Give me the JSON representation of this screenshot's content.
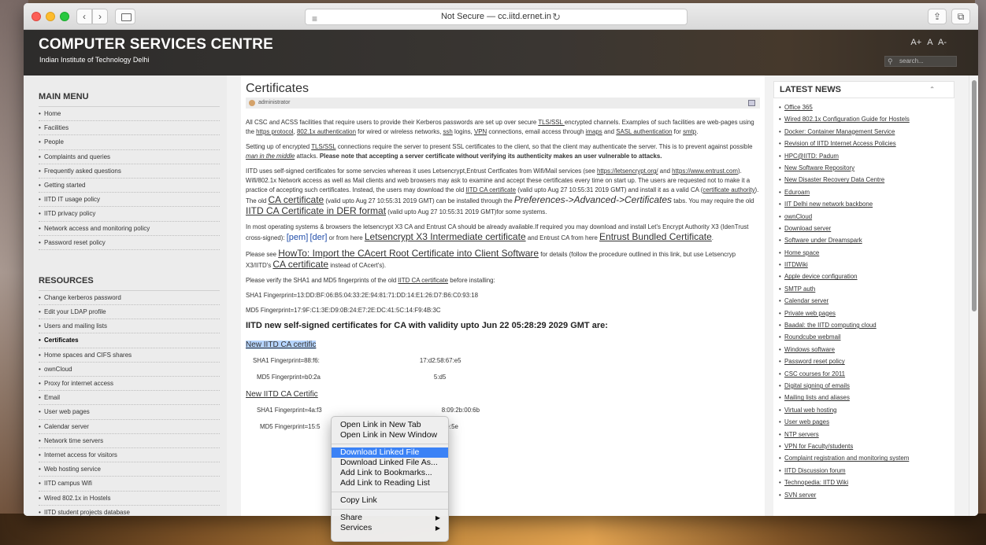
{
  "browser": {
    "address": "Not Secure — cc.iitd.ernet.in"
  },
  "site": {
    "title": "COMPUTER SERVICES CENTRE",
    "subtitle": "Indian Institute of Technology Delhi",
    "font_controls": [
      "A+",
      "A",
      "A-"
    ],
    "search_placeholder": "search..."
  },
  "main_menu": {
    "title": "MAIN MENU",
    "items": [
      "Home",
      "Facilities",
      "People",
      "Complaints and queries",
      "Frequently asked questions",
      "Getting started",
      "IITD IT usage policy",
      "IITD privacy policy",
      "Network access and monitoring policy",
      "Password reset policy"
    ]
  },
  "resources": {
    "title": "RESOURCES",
    "items": [
      "Change kerberos password",
      "Edit your LDAP profile",
      "Users and mailing lists",
      "Certificates",
      "Home spaces and CIFS shares",
      "ownCloud",
      "Proxy for internet access",
      "Email",
      "User web pages",
      "Calendar server",
      "Network time servers",
      "Internet access for visitors",
      "Web hosting service",
      "IITD campus Wifi",
      "Wired 802.1x in Hostels",
      "IITD student projects database"
    ],
    "active": "Certificates"
  },
  "article": {
    "title": "Certificates",
    "author": "administrator",
    "p1_a": "All CSC and ACSS facilities that require users to provide their Kerberos passwords are set up over secure ",
    "p1_tls": "TLS/SSL ",
    "p1_b": "encrypted channels. Examples of such facilities are web-pages using the ",
    "p1_https": "https protocol",
    "p1_c": ", ",
    "p1_8021x": "802.1x authentication",
    "p1_d": " for wired or wireless networks, ",
    "p1_ssh": "ssh",
    "p1_e": " logins, ",
    "p1_vpn": "VPN",
    "p1_f": " connections, email access through ",
    "p1_imaps": "imaps",
    "p1_g": " and ",
    "p1_sasl": "SASL authentication",
    "p1_h": " for ",
    "p1_smtp": "smtp",
    "p1_i": ".",
    "p2_a": "Setting up of encrypted ",
    "p2_tls": "TLS/SSL",
    "p2_b": " connections require the server  to present SSL certificates to the client, so that the client may authenticate the server. This is to prevent against possible ",
    "p2_mitm": "man in the middle",
    "p2_c": " attacks. ",
    "p2_bold": "Please note that accepting a server certificate without verifying its authenticity makes an user vulnerable to attacks.",
    "p3_a": "IITD uses self-signed certificates for some servcies whereas it uses Letsencrypt,Entrust Certficates from Wifi/Mail services (see ",
    "p3_le": "https://letsencrypt.org/",
    "p3_b": " and ",
    "p3_entrust": "https://www.entrust.com",
    "p3_c": ").  Wifi/802.1x Network access as well as Mail clients and web browsers  may ask to examine and accept these certificates every time on start up. The users are requested not to make it a practice of accepting such certificates. Instead, the users may download the old ",
    "p3_oldca": "IITD CA certificate",
    "p3_d": " (valid upto Aug 27 10:55:31 2019 GMT) and install it as a valid CA (",
    "p3_certauth": "certificate authority",
    "p3_e": "). The old ",
    "p3_cacert": "CA certificate",
    "p3_f": " (valid upto Aug 27 10:55:31 2019 GMT) can be installed through the ",
    "p3_prefs": "Preferences->Advanced->Certificates",
    "p3_g": " tabs. You may require the old ",
    "p3_der": "IITD CA Certificate in DER format",
    "p3_h": " (valid upto Aug 27 10:55:31 2019 GMT)for some systems.",
    "p4_a": "In most operating systems & browsers the letsencrypt X3 CA and Entrust CA should be already available.If required you may download and install Let's Encrypt Authority X3 (IdenTrust cross-signed): ",
    "p4_pem": "[pem]",
    "p4_der": "[der]",
    "p4_b": " or from here ",
    "p4_lex3": "Letsencrypt X3 Intermediate certificate",
    "p4_c": " and Entrust CA from here ",
    "p4_entrust": "Entrust Bundled Certificate",
    "p4_d": ".",
    "p5_a": "Please see ",
    "p5_howto": "HowTo: Import the CAcert Root Certificate into Client Software",
    "p5_b": " for details (follow the procedure outlined in this link, but use Letsencryp X3/IITD's ",
    "p5_ca": "CA certificate",
    "p5_c": " instead of CAcert's).",
    "p6_a": "Please verify the SHA1 and MD5 fingerprints of the old ",
    "p6_link": "IITD CA certificate",
    "p6_b": " before installing:",
    "sha1_old": "SHA1 Fingerprint=13:DD:BF:06:B5:04:33:2E:94:81:71:DD:14:E1:26:D7:B6:C0:93:18",
    "md5_old": "MD5 Fingerprint=17:9F:C1:3E:D9:0B:24:E7:2E:DC:41:5C:14:F9:4B:3C",
    "new_heading": "IITD new self-signed certificates for CA with validity upto Jun 22 05:28:29 2029 GMT are:",
    "new1_link": "New IITD CA certific",
    "new1_sha1_a": "SHA1 Fingerprint=88:f6:",
    "new1_sha1_b": "17:d2:58:67:e5",
    "new1_md5_a": "MD5  Fingerprint=b0:2a",
    "new1_md5_b": "5:d5",
    "new2_link": "New IITD CA Certific",
    "new2_sha1_a": "SHA1 Fingerprint=4a:f3",
    "new2_sha1_b": "8:09:2b:00:6b",
    "new2_md5_a": "MD5  Fingerprint=15:5",
    "new2_md5_b": "e:5e"
  },
  "news": {
    "title": "LATEST NEWS",
    "items": [
      "Office 365",
      "Wired 802.1x Configuration Guide for Hostels",
      "Docker: Container Management Service",
      "Revision of IITD Internet Access Policies",
      "HPC@IITD: Padum",
      "New Software Repository",
      "New Disaster Recovery Data Centre",
      "Eduroam",
      "IIT Delhi new network backbone",
      "ownCloud",
      "Download server",
      "Software under Dreamspark",
      "Home space",
      "IITDWiki",
      "Apple device configuration",
      "SMTP auth",
      "Calendar server",
      "Private web pages",
      "Baadal: the IITD computing cloud",
      "Roundcube webmail",
      "Windows software",
      "Password reset policy",
      "CSC courses for 2011",
      "Digital signing of emails",
      "Mailing lists and aliases",
      "Virtual web hosting",
      "User web pages",
      "NTP servers",
      "VPN for Faculty/students",
      "Complaint registration and monitoring system",
      "IITD Discussion forum",
      "Technopedia: IITD Wiki",
      "SVN server"
    ]
  },
  "context_menu": {
    "open_new_tab": "Open Link in New Tab",
    "open_new_window": "Open Link in New Window",
    "download": "Download Linked File",
    "download_as": "Download Linked File As...",
    "add_bookmarks": "Add Link to Bookmarks...",
    "add_reading": "Add Link to Reading List",
    "copy": "Copy Link",
    "share": "Share",
    "services": "Services"
  }
}
